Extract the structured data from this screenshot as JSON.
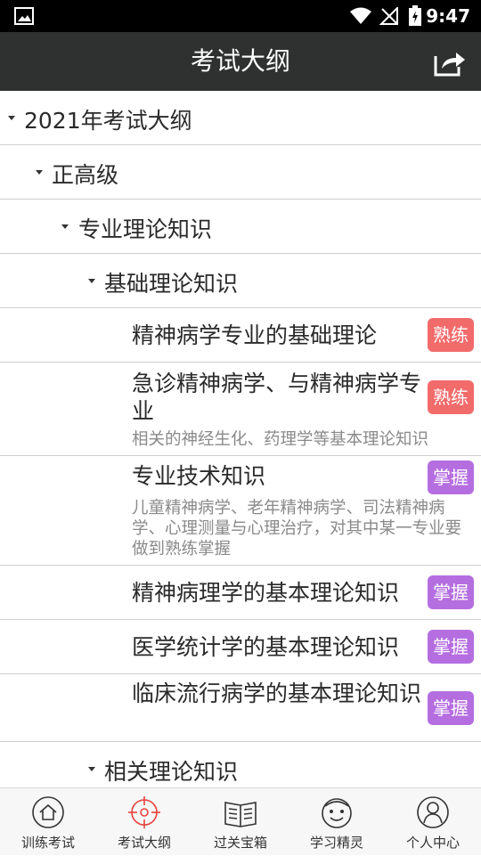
{
  "status": {
    "time": "9:47"
  },
  "header": {
    "title": "考试大纲"
  },
  "tree": {
    "root": "2021年考试大纲",
    "level1": "正高级",
    "level2": "专业理论知识",
    "level3": "基础理论知识",
    "level3b": "相关理论知识"
  },
  "items": [
    {
      "name": "精神病学专业的基础理论",
      "badge": "熟练",
      "desc": ""
    },
    {
      "name": "急诊精神病学、与精神病学专业",
      "badge": "熟练",
      "desc": "相关的神经生化、药理学等基本理论知识"
    },
    {
      "name": "专业技术知识",
      "badge": "掌握",
      "desc": "儿童精神病学、老年精神病学、司法精神病学、心理测量与心理治疗，对其中某一专业要做到熟练掌握"
    },
    {
      "name": "精神病理学的基本理论知识",
      "badge": "掌握",
      "desc": ""
    },
    {
      "name": "医学统计学的基本理论知识",
      "badge": "掌握",
      "desc": ""
    },
    {
      "name": "临床流行病学的基本理论知识",
      "badge": "掌握",
      "desc": ""
    }
  ],
  "tabs": [
    {
      "label": "训练考试",
      "icon": "home-icon"
    },
    {
      "label": "考试大纲",
      "icon": "target-icon"
    },
    {
      "label": "过关宝箱",
      "icon": "book-icon"
    },
    {
      "label": "学习精灵",
      "icon": "smiley-icon"
    },
    {
      "label": "个人中心",
      "icon": "user-icon"
    }
  ],
  "colors": {
    "header_bg": "#2f3131",
    "accent": "#e8413c",
    "badge_familiar": "#f26b6b",
    "badge_master": "#b56ee0"
  }
}
